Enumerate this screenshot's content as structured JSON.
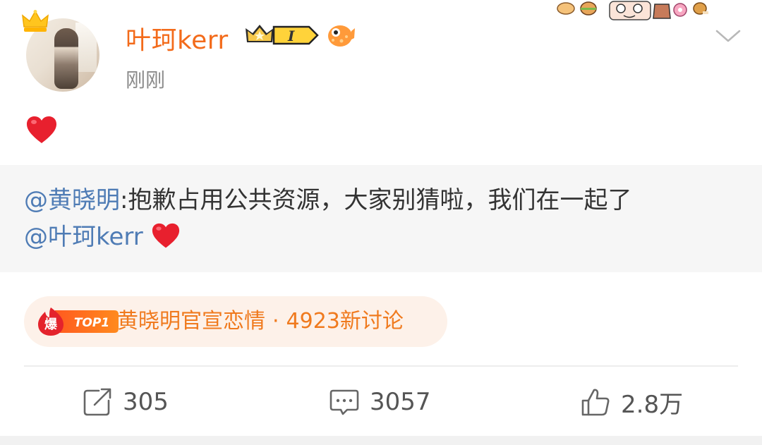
{
  "post": {
    "username": "叶珂kerr",
    "vip_level": "I",
    "time": "刚刚",
    "content_emoji": "red-heart-emoji"
  },
  "repost": {
    "author": "@黄晓明",
    "text": ":抱歉占用公共资源，大家别猜啦，我们在一起了",
    "mention": "@叶珂kerr",
    "trailing_emoji": "red-heart-emoji"
  },
  "trending": {
    "badge": "爆",
    "rank": "TOP1",
    "topic": "黄晓明官宣恋情",
    "separator": "·",
    "discussion": "4923新讨论"
  },
  "actions": {
    "repost_count": "305",
    "comment_count": "3057",
    "like_count": "2.8万"
  },
  "colors": {
    "username": "#f36b1b",
    "mention": "#4f7cb5",
    "trending_text": "#f07a1e",
    "trending_bg": "#fdf1e9",
    "repost_bg": "#f6f6f6"
  }
}
